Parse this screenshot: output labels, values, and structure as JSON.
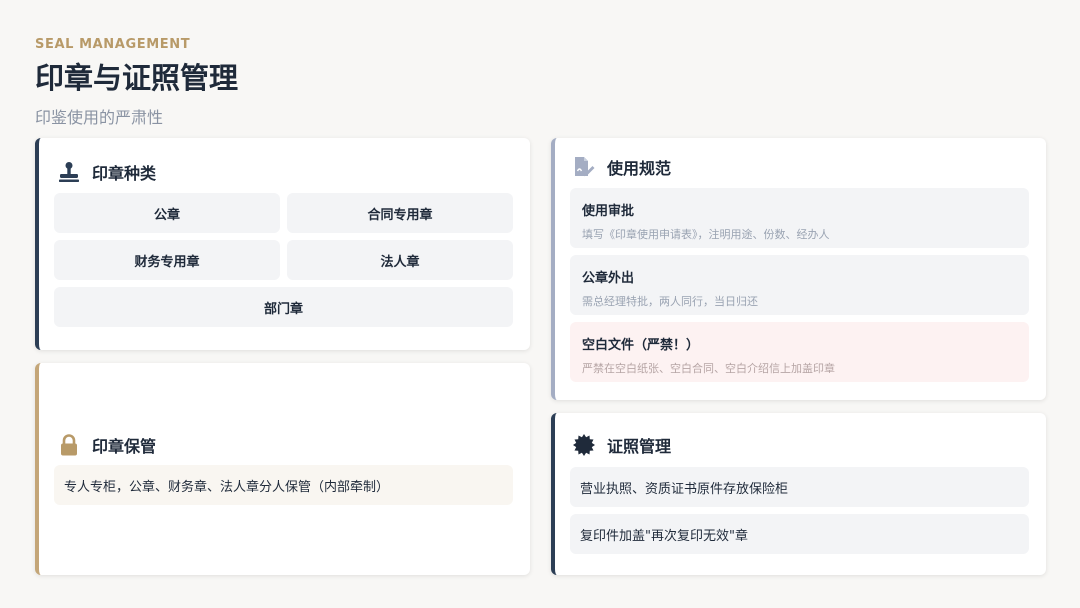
{
  "header": {
    "eyebrow": "SEAL MANAGEMENT",
    "title": "印章与证照管理",
    "subtitle": "印鉴使用的严肃性"
  },
  "seal_types": {
    "title": "印章种类",
    "icon": "stamp-icon",
    "items": [
      "公章",
      "合同专用章",
      "财务专用章",
      "法人章",
      "部门章"
    ]
  },
  "seal_storage": {
    "title": "印章保管",
    "icon": "lock-icon",
    "text": "专人专柜，公章、财务章、法人章分人保管（内部牵制）"
  },
  "usage_rules": {
    "title": "使用规范",
    "icon": "document-sign-icon",
    "rules": [
      {
        "title": "使用审批",
        "desc": "填写《印章使用申请表》，注明用途、份数、经办人"
      },
      {
        "title": "公章外出",
        "desc": "需总经理特批，两人同行，当日归还"
      },
      {
        "title": "空白文件（严禁！）",
        "desc": "严禁在空白纸张、空白合同、空白介绍信上加盖印章"
      }
    ]
  },
  "license_management": {
    "title": "证照管理",
    "icon": "certificate-badge-icon",
    "items": [
      "营业执照、资质证书原件存放保险柜",
      "复印件加盖\"再次复印无效\"章"
    ]
  },
  "colors": {
    "accent_gold": "#b89a68",
    "navy": "#2c3e55",
    "slate": "#a4adc3",
    "danger_bg": "#fdf2f2"
  }
}
